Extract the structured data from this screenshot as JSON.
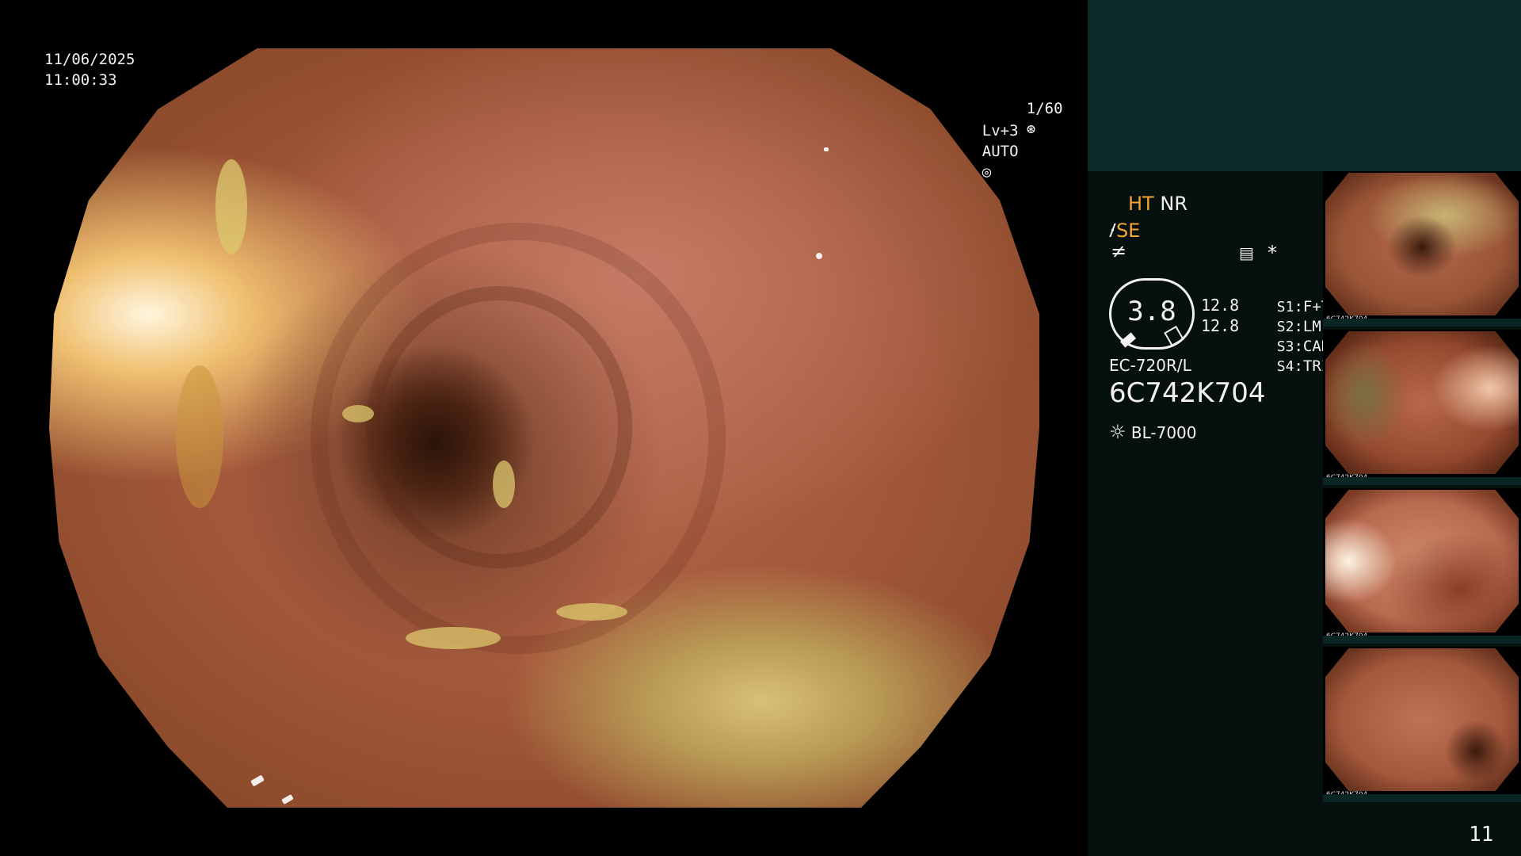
{
  "overlay": {
    "date": "11/06/2025",
    "time": "11:00:33",
    "shutter": "1/60",
    "shutter_icon": "aperture-icon",
    "level": "Lv+3",
    "exposure_mode": "AUTO",
    "exposure_icon": "iris-icon"
  },
  "panel": {
    "ht_label": "HT",
    "nr_label": "NR",
    "se_label": "SE",
    "se_icon": "scope-hand-icon",
    "sub_icon": "not-equal-icon",
    "doc_icon": "settings-doc-icon",
    "asterisk": "*",
    "dial_value": "3.8",
    "level_top": "12.8",
    "level_bottom": "12.8",
    "switches": [
      {
        "key": "S1",
        "value": "F+T"
      },
      {
        "key": "S2",
        "value": "LM"
      },
      {
        "key": "S3",
        "value": "CAD"
      },
      {
        "key": "S4",
        "value": "TRIG"
      }
    ],
    "scope_model": "EC-720R/L",
    "serial": "6C742K704",
    "light_source_icon": "sun-icon",
    "light_source": "BL-7000",
    "accent_color": "#f6a531"
  },
  "thumbnails": [
    {
      "label": "6C742K704"
    },
    {
      "label": "6C742K704"
    },
    {
      "label": "6C742K704"
    },
    {
      "label": "6C742K704"
    }
  ],
  "image_count": "11"
}
